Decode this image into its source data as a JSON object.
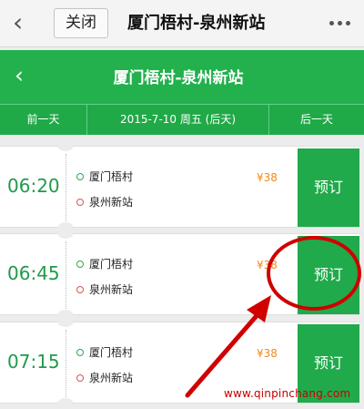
{
  "wechat_bar": {
    "back_icon": "chevron-left-icon",
    "close_label": "关闭",
    "title": "厦门梧村-泉州新站",
    "more_icon": "more-dots-icon"
  },
  "header": {
    "back_icon": "chevron-left-icon",
    "title": "厦门梧村-泉州新站"
  },
  "date_nav": {
    "prev_label": "前一天",
    "current_date": "2015-7-10 周五 (后天)",
    "next_label": "后一天"
  },
  "trips": [
    {
      "time": "06:20",
      "from": "厦门梧村",
      "to": "泉州新站",
      "price": "¥38",
      "book_label": "预订"
    },
    {
      "time": "06:45",
      "from": "厦门梧村",
      "to": "泉州新站",
      "price": "¥38",
      "book_label": "预订"
    },
    {
      "time": "07:15",
      "from": "厦门梧村",
      "to": "泉州新站",
      "price": "¥38",
      "book_label": "预订"
    }
  ],
  "watermark": "www.qinpinchang.com",
  "colors": {
    "brand_green": "#22b14c",
    "price_orange": "#f08b1d",
    "annotation_red": "#d00000"
  }
}
